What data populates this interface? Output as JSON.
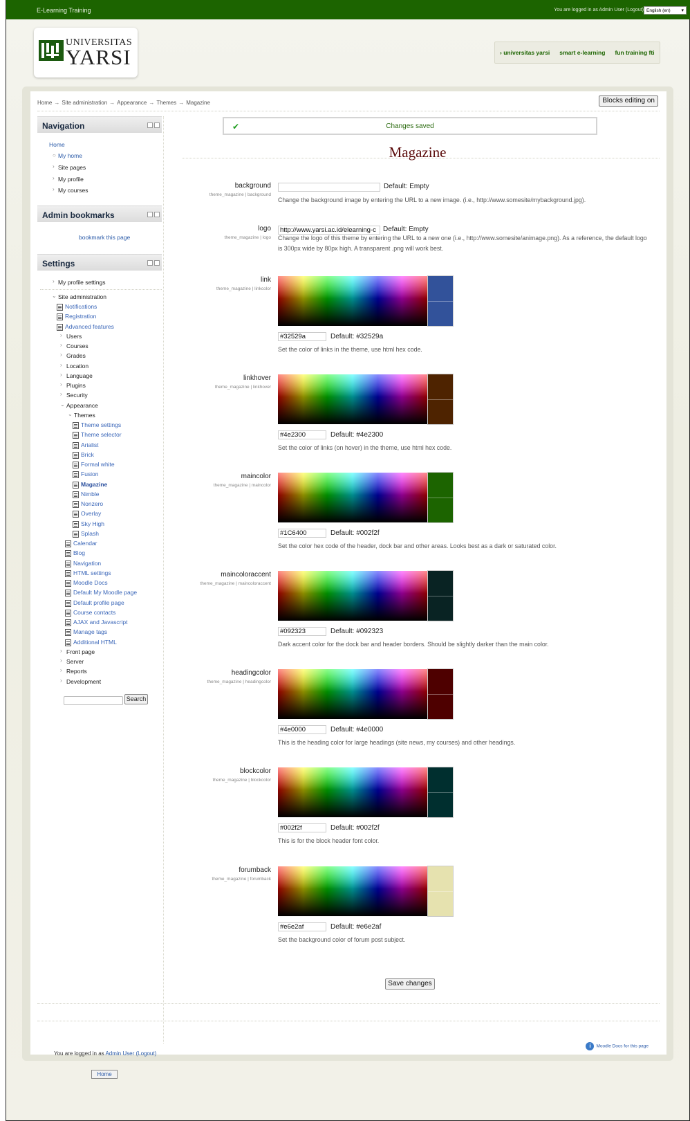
{
  "topbar": {
    "site_name": "E-Learning Training",
    "login_text": "You are logged in as Admin User (Logout)",
    "language": "English (en)"
  },
  "logo": {
    "line1": "UNIVERSITAS",
    "line2": "YARSI"
  },
  "custommenu": [
    "› universitas yarsi",
    "smart e-learning",
    "fun training fti"
  ],
  "breadcrumb": [
    "Home",
    "Site administration",
    "Appearance",
    "Themes",
    "Magazine"
  ],
  "blocks_editing_button": "Blocks editing on",
  "navigation": {
    "title": "Navigation",
    "home": "Home",
    "items": [
      "My home",
      "Site pages",
      "My profile",
      "My courses"
    ]
  },
  "admin_bookmarks": {
    "title": "Admin bookmarks",
    "link": "bookmark this page"
  },
  "settings": {
    "title": "Settings",
    "my_profile": "My profile settings",
    "site_admin": "Site administration",
    "sa_links": [
      "Notifications",
      "Registration",
      "Advanced features"
    ],
    "sa_folders": [
      "Users",
      "Courses",
      "Grades",
      "Location",
      "Language",
      "Plugins",
      "Security"
    ],
    "appearance": "Appearance",
    "themes": "Themes",
    "themes_items": [
      "Theme settings",
      "Theme selector",
      "Arialist",
      "Brick",
      "Formal white",
      "Fusion",
      "Magazine",
      "Nimble",
      "Nonzero",
      "Overlay",
      "Sky High",
      "Splash"
    ],
    "appearance_items": [
      "Calendar",
      "Blog",
      "Navigation",
      "HTML settings",
      "Moodle Docs",
      "Default My Moodle page",
      "Default profile page",
      "Course contacts",
      "AJAX and Javascript",
      "Manage tags",
      "Additional HTML"
    ],
    "sa_tail": [
      "Front page",
      "Server",
      "Reports",
      "Development"
    ],
    "search_button": "Search"
  },
  "notice": "Changes saved",
  "page_title": "Magazine",
  "text_settings": [
    {
      "label": "background",
      "key": "theme_magazine | background",
      "value": "",
      "default": "Default: Empty",
      "desc": "Change the background image by entering the URL to a new image. (i.e., http://www.somesite/mybackground.jpg)."
    },
    {
      "label": "logo",
      "key": "theme_magazine | logo",
      "value": "http://www.yarsi.ac.id/elearning-c",
      "default": "Default: Empty",
      "desc": "Change the logo of this theme by entering the URL to a new one (i.e., http://www.somesite/animage.png). As a reference, the default logo is 300px wide by 80px high. A transparent .png will work best."
    }
  ],
  "color_settings": [
    {
      "label": "link",
      "key": "theme_magazine | linkcolor",
      "value": "#32529a",
      "default": "Default: #32529a",
      "swatch": "#32529a",
      "desc": "Set the color of links in the theme, use html hex code."
    },
    {
      "label": "linkhover",
      "key": "theme_magazine | linkhover",
      "value": "#4e2300",
      "default": "Default: #4e2300",
      "swatch": "#4e2300",
      "desc": "Set the color of links (on hover) in the theme, use html hex code."
    },
    {
      "label": "maincolor",
      "key": "theme_magazine | maincolor",
      "value": "#1C6400",
      "default": "Default: #002f2f",
      "swatch": "#1c6400",
      "desc": "Set the color hex code of the header, dock bar and other areas. Looks best as a dark or saturated color."
    },
    {
      "label": "maincoloraccent",
      "key": "theme_magazine | maincoloraccent",
      "value": "#092323",
      "default": "Default: #092323",
      "swatch": "#092323",
      "desc": "Dark accent color for the dock bar and header borders. Should be slightly darker than the main color."
    },
    {
      "label": "headingcolor",
      "key": "theme_magazine | headingcolor",
      "value": "#4e0000",
      "default": "Default: #4e0000",
      "swatch": "#4e0000",
      "desc": "This is the heading color for large headings (site news, my courses) and other headings."
    },
    {
      "label": "blockcolor",
      "key": "theme_magazine | blockcolor",
      "value": "#002f2f",
      "default": "Default: #002f2f",
      "swatch": "#002f2f",
      "desc": "This is for the block header font color."
    },
    {
      "label": "forumback",
      "key": "theme_magazine | forumback",
      "value": "#e6e2af",
      "default": "Default: #e6e2af",
      "swatch": "#e6e2af",
      "desc": "Set the background color of forum post subject."
    }
  ],
  "save_button": "Save changes",
  "footer": {
    "login_prefix": "You are logged in as ",
    "login_user": "Admin User",
    "login_logout": "(Logout)",
    "docs_link": "Moodle Docs for this page",
    "home_button": "Home"
  }
}
